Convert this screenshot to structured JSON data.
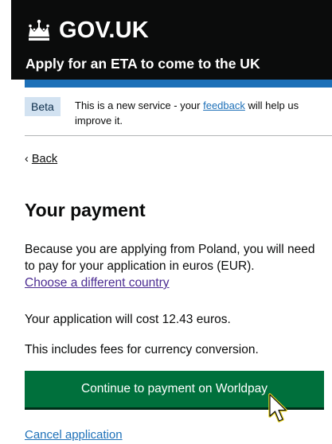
{
  "header": {
    "logo_text": "GOV.UK",
    "service_name": "Apply for an ETA to come to the UK"
  },
  "phase_banner": {
    "tag": "Beta",
    "text_before": "This is a new service - your ",
    "link": "feedback",
    "text_after": " will help us improve it."
  },
  "back_link": "Back",
  "page": {
    "title": "Your payment",
    "para1": "Because you are applying from Poland, you will need to pay for your application in euros (EUR).",
    "change_country_link": "Choose a different country",
    "cost_text": "Your application will cost 12.43 euros.",
    "fees_text": "This includes fees for currency conversion.",
    "continue_button": "Continue to payment on Worldpay",
    "cancel_link": "Cancel application"
  },
  "colors": {
    "header_bg": "#0b0c0c",
    "blue_bar": "#1d70b8",
    "button_green": "#00703c",
    "link_blue": "#1d70b8",
    "visited_link": "#4c2c92"
  },
  "icons": {
    "logo": "crown-icon",
    "back": "chevron-left-icon",
    "cursor": "mouse-pointer-icon"
  }
}
